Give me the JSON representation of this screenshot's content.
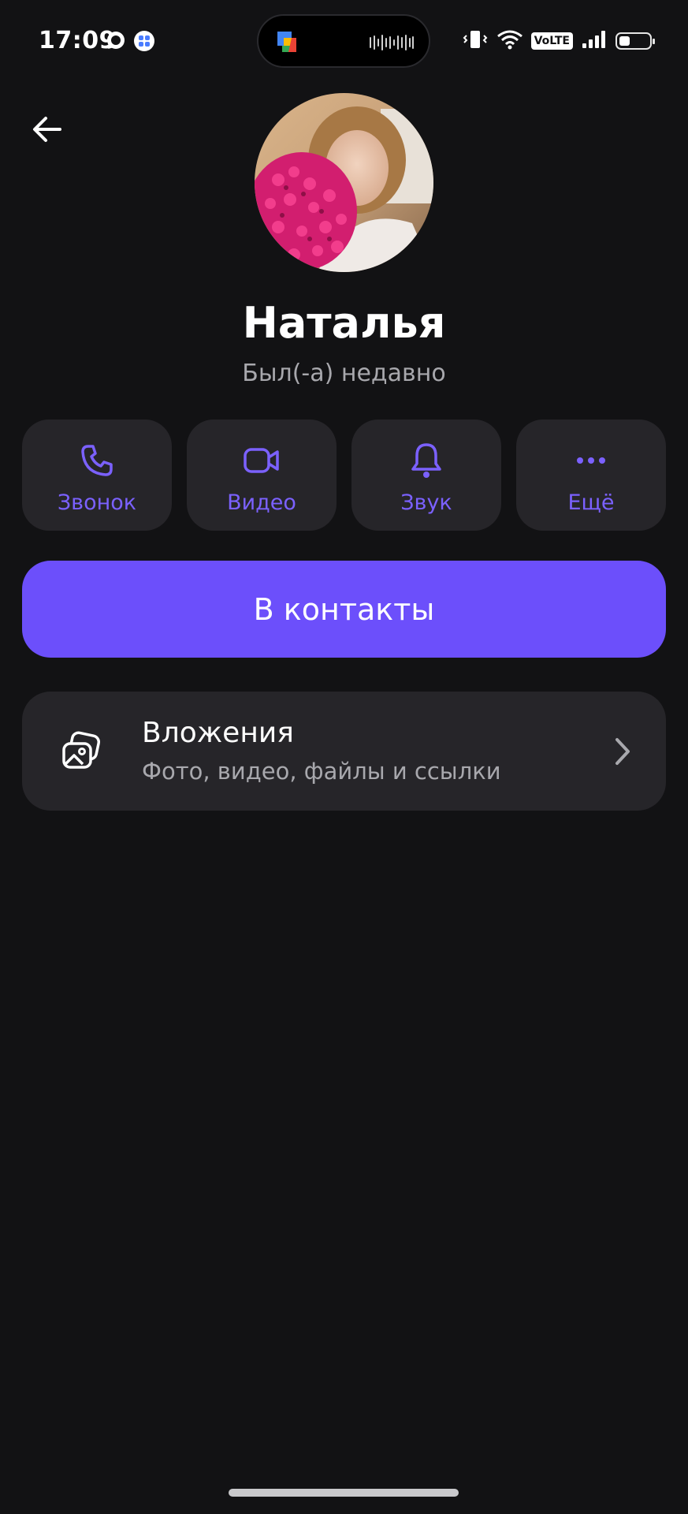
{
  "status_bar": {
    "time": "17:09",
    "volte": "VoLTE",
    "battery_level": 0.35
  },
  "profile": {
    "name": "Наталья",
    "status": "Был(-а) недавно"
  },
  "actions": [
    {
      "label": "Звонок",
      "icon": "phone-icon"
    },
    {
      "label": "Видео",
      "icon": "video-icon"
    },
    {
      "label": "Звук",
      "icon": "bell-icon"
    },
    {
      "label": "Ещё",
      "icon": "more-dots-icon"
    }
  ],
  "add_contact": {
    "label": "В контакты"
  },
  "attachments": {
    "title": "Вложения",
    "subtitle": "Фото, видео, файлы и ссылки",
    "icon": "gallery-icon"
  },
  "colors": {
    "background": "#121214",
    "card": "#262529",
    "accent": "#6c4ffb",
    "accent_text": "#7b61ff",
    "secondary_text": "#a8a8ad"
  }
}
